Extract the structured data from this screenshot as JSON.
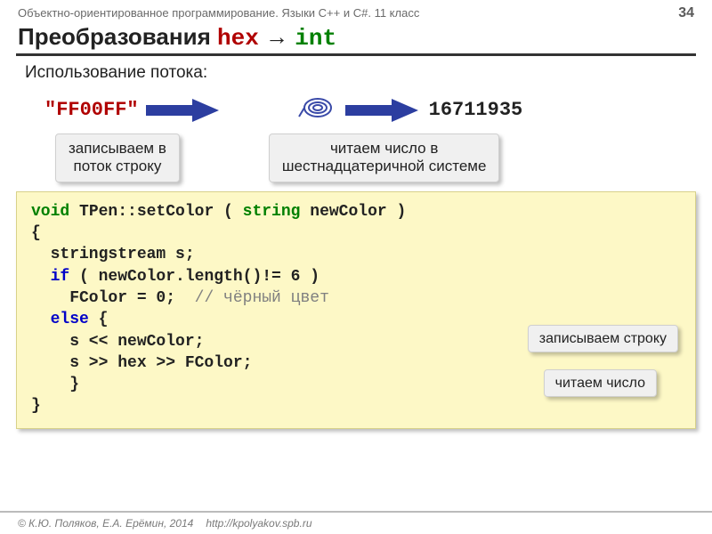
{
  "header": {
    "course": "Объектно-ориентированное программирование. Языки C++ и C#. 11 класс",
    "page_number": "34"
  },
  "title": {
    "prefix": "Преобразования ",
    "hex_word": "hex",
    "arrow": " → ",
    "int_word": "int"
  },
  "subtitle": "Использование потока:",
  "example": {
    "hex_literal": "\"FF00FF\"",
    "int_literal": "16711935"
  },
  "callouts": {
    "write_stream": "записываем в\nпоток строку",
    "read_stream": "читаем число в\nшестнадцатеричной системе",
    "write_string": "записываем строку",
    "read_number": "читаем число"
  },
  "code": {
    "l1_void": "void",
    "l1_rest": " TPen::setColor ( ",
    "l1_string": "string",
    "l1_param": " newColor )",
    "l2": "{",
    "l3": "  stringstream s;",
    "l4_if": "  if",
    "l4_cond": " ( newColor.length()!= 6 )",
    "l5_body": "    FColor = 0;  ",
    "l5_comment": "// чёрный цвет",
    "l6_else": "  else",
    "l6_brace": " {",
    "l7": "    s << newColor;",
    "l8": "    s >> hex >> FColor;",
    "l9": "    }",
    "l10": "}"
  },
  "footer": {
    "copyright": "© К.Ю. Поляков, Е.А. Ерёмин, 2014",
    "url": "http://kpolyakov.spb.ru"
  }
}
